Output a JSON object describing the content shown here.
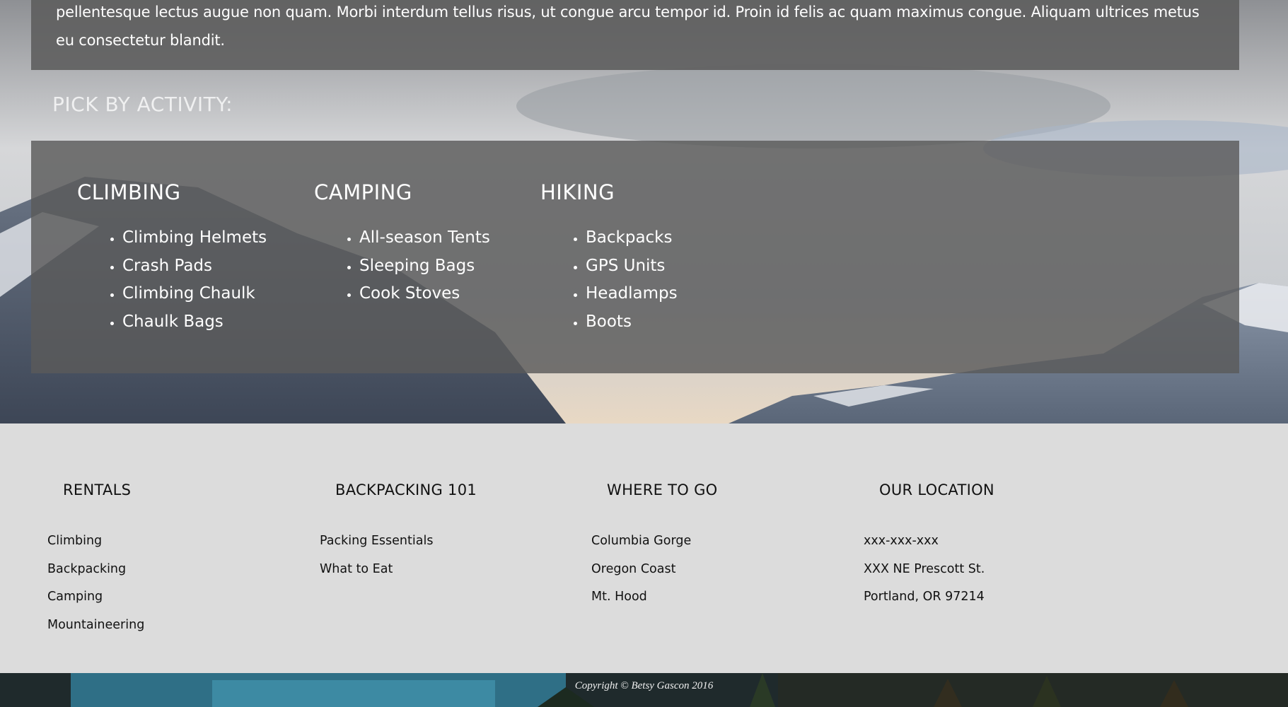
{
  "intro": {
    "text": "pellentesque lectus augue non quam. Morbi interdum tellus risus, ut congue arcu tempor id. Proin id felis ac quam maximus congue. Aliquam ultrices metus eu consectetur blandit."
  },
  "activities": {
    "heading": "PICK BY ACTIVITY:",
    "columns": [
      {
        "title": "CLIMBING",
        "items": [
          "Climbing Helmets",
          "Crash Pads",
          "Climbing Chaulk",
          "Chaulk Bags"
        ]
      },
      {
        "title": "CAMPING",
        "items": [
          "All-season Tents",
          "Sleeping Bags",
          "Cook Stoves"
        ]
      },
      {
        "title": "HIKING",
        "items": [
          "Backpacks",
          "GPS Units",
          "Headlamps",
          "Boots"
        ]
      }
    ]
  },
  "footer": {
    "columns": [
      {
        "title": "RENTALS",
        "items": [
          "Climbing",
          "Backpacking",
          "Camping",
          "Mountaineering"
        ]
      },
      {
        "title": "BACKPACKING 101",
        "items": [
          "Packing Essentials",
          "What to Eat"
        ]
      },
      {
        "title": "WHERE TO GO",
        "items": [
          "Columbia Gorge",
          "Oregon Coast",
          "Mt. Hood"
        ]
      },
      {
        "title": "OUR LOCATION",
        "items": [
          "xxx-xxx-xxx",
          "XXX NE Prescott St.",
          "Portland, OR 97214"
        ]
      }
    ],
    "copyright": "Copyright © Betsy Gascon 2016"
  },
  "colors": {
    "panel": "#5c5c5c",
    "footer_bg": "#dcdcdc",
    "text_light": "#ffffff",
    "text_dark": "#111111"
  }
}
